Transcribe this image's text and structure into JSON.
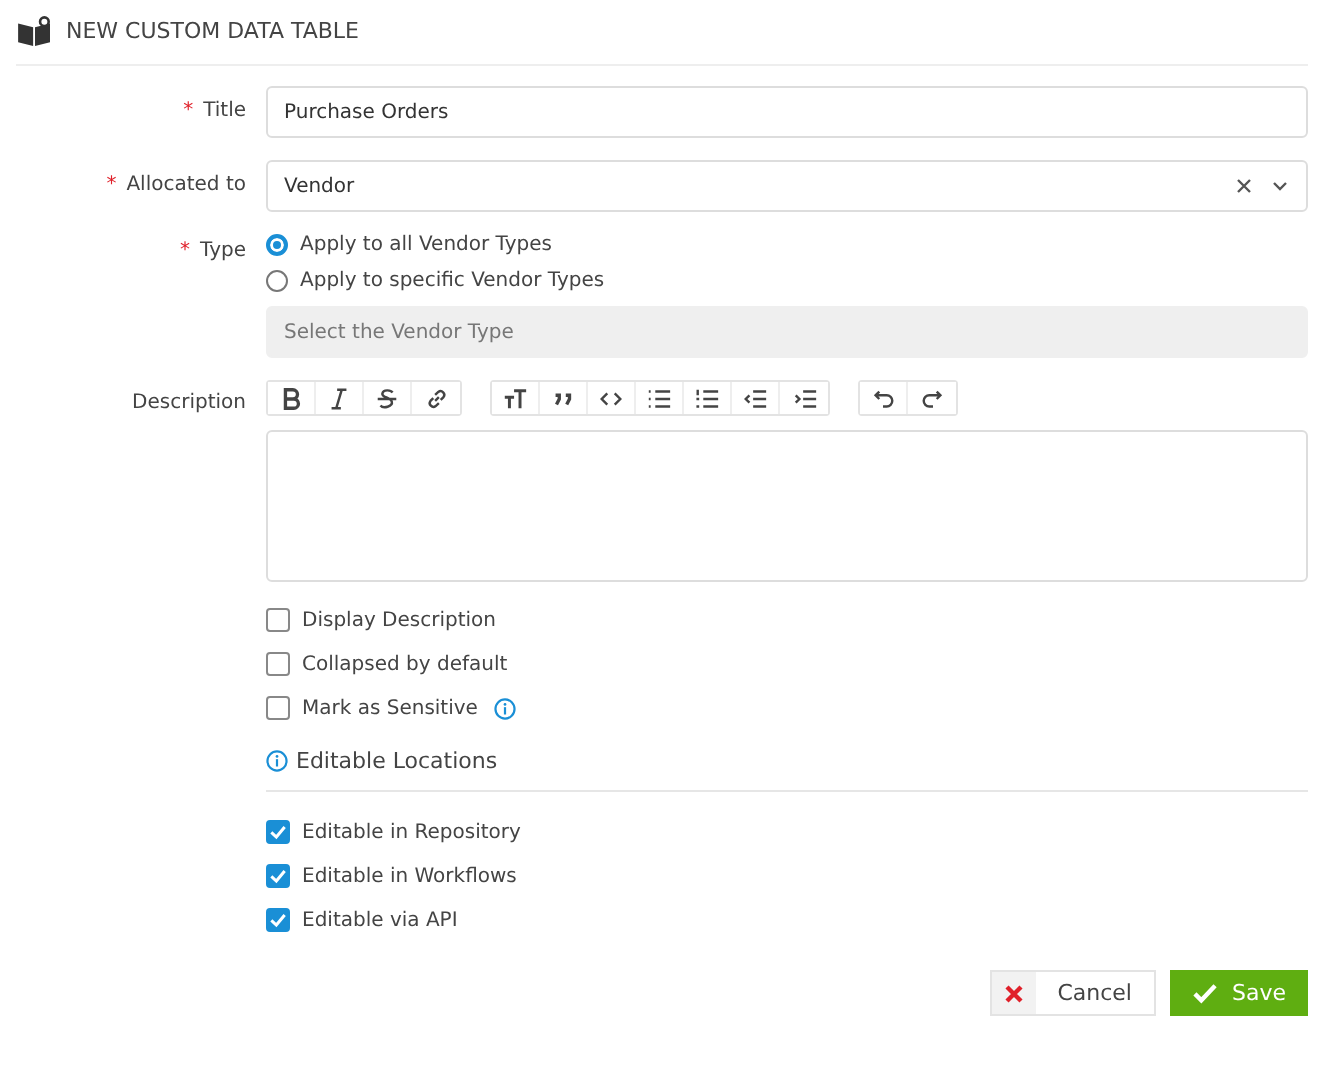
{
  "header": {
    "title": "NEW CUSTOM DATA TABLE"
  },
  "title_field": {
    "label": "Title",
    "required_mark": "*",
    "value": "Purchase Orders"
  },
  "allocated_field": {
    "label": "Allocated to",
    "required_mark": "*",
    "value": "Vendor"
  },
  "type_field": {
    "label": "Type",
    "required_mark": "*",
    "options": [
      {
        "label": "Apply to all Vendor Types",
        "selected": true
      },
      {
        "label": "Apply to specific Vendor Types",
        "selected": false
      }
    ],
    "vendor_type_select": {
      "placeholder": "Select the Vendor Type",
      "disabled": true
    }
  },
  "description_field": {
    "label": "Description"
  },
  "options": [
    {
      "label": "Display Description",
      "checked": false,
      "info": false
    },
    {
      "label": "Collapsed by default",
      "checked": false,
      "info": false
    },
    {
      "label": "Mark as Sensitive",
      "checked": false,
      "info": true
    }
  ],
  "editable_locations": {
    "heading": "Editable Locations",
    "items": [
      {
        "label": "Editable in Repository",
        "checked": true
      },
      {
        "label": "Editable in Workflows",
        "checked": true
      },
      {
        "label": "Editable via API",
        "checked": true
      }
    ]
  },
  "buttons": {
    "cancel": "Cancel",
    "save": "Save"
  }
}
